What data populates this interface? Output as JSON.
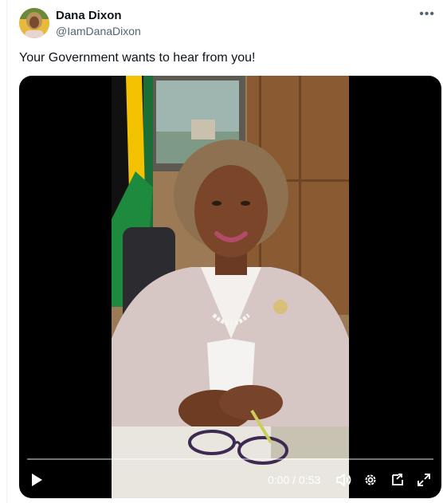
{
  "author": {
    "name": "Dana Dixon",
    "handle": "@IamDanaDixon",
    "avatar_icon": "profile-photo"
  },
  "more_icon": "more-options-icon",
  "post": {
    "text": "Your Government wants to hear from you!"
  },
  "video": {
    "current_time": "0:00",
    "separator": " / ",
    "duration": "0:53",
    "progress_fraction": 0,
    "icons": [
      "play-icon",
      "volume-icon",
      "settings-icon",
      "picture-in-picture-icon",
      "fullscreen-icon"
    ]
  }
}
